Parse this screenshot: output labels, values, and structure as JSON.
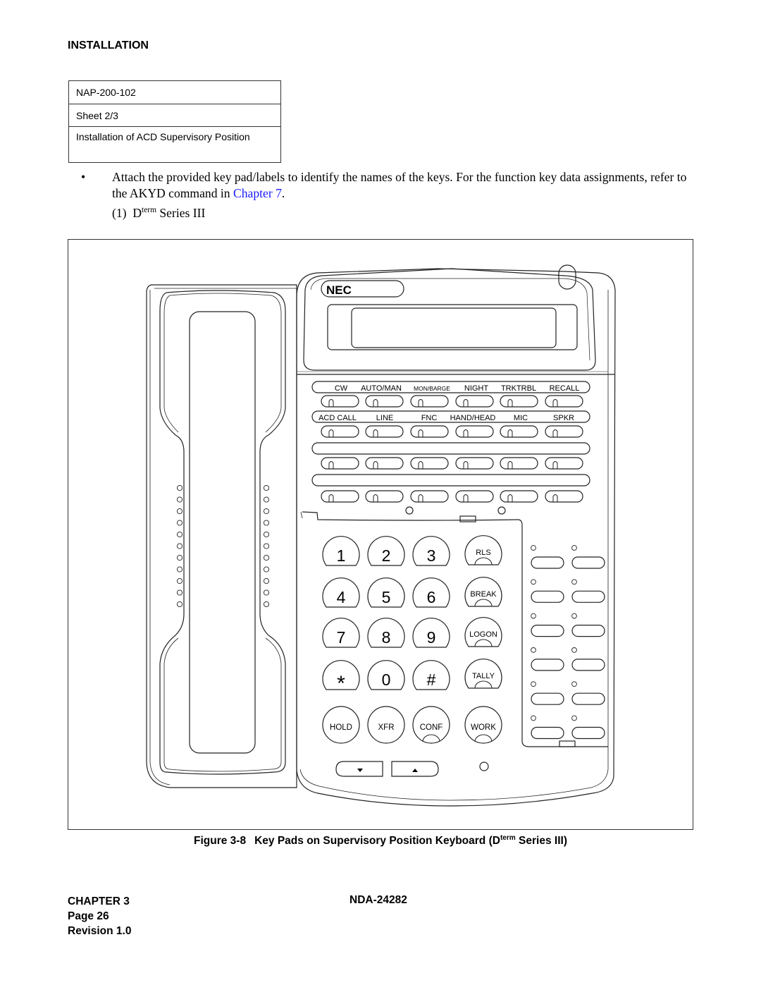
{
  "header": {
    "section": "INSTALLATION"
  },
  "reference_table": {
    "rows": [
      "NAP-200-102",
      "Sheet 2/3",
      "Installation of ACD Supervisory Position"
    ]
  },
  "body": {
    "bullet_symbol": "•",
    "bullet_text": "Attach the provided key pad/labels to identify the names of the keys. For the function key data assignments, refer to the AKYD command in ",
    "bullet_link": "Chapter 7",
    "bullet_end": ".",
    "sub_item_number": "(1)",
    "sub_item_D": "D",
    "sub_item_sup": "term",
    "sub_item_rest": " Series III"
  },
  "phone": {
    "brand": "NEC",
    "function_label_row_1": [
      "CW",
      "AUTO/MAN",
      "MON/BARGE",
      "NIGHT",
      "TRKTRBL",
      "RECALL"
    ],
    "function_label_row_2": [
      "ACD CALL",
      "LINE",
      "FNC",
      "HAND/HEAD",
      "MIC",
      "SPKR"
    ],
    "dialpad_keys": [
      "1",
      "2",
      "3",
      "4",
      "5",
      "6",
      "7",
      "8",
      "9",
      "*",
      "0",
      "#"
    ],
    "side_keys": [
      "RLS",
      "BREAK",
      "LOGON",
      "TALLY"
    ],
    "bottom_keys": [
      "HOLD",
      "XFR",
      "CONF",
      "WORK"
    ],
    "volume_down_icon": "▼",
    "volume_up_icon": "▲"
  },
  "figure": {
    "label": "Figure 3-8",
    "caption_before": "Key Pads on Supervisory Position Keyboard (D",
    "caption_sup": "term",
    "caption_after": " Series III)"
  },
  "footer": {
    "chapter": "CHAPTER 3",
    "page": "Page 26",
    "revision": "Revision 1.0",
    "doc_number": "NDA-24282"
  }
}
